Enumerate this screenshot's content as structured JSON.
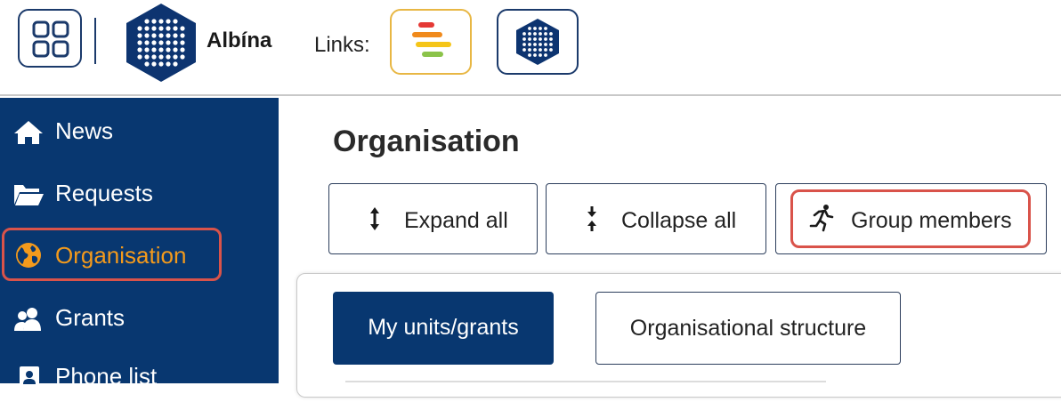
{
  "header": {
    "brand": "Albína",
    "links_label": "Links:",
    "icons": [
      "apps-grid-icon",
      "albina-logo-icon",
      "avalanche-report-link-icon",
      "albina-link-icon"
    ]
  },
  "sidebar": {
    "items": [
      {
        "label": "News",
        "icon": "home-icon"
      },
      {
        "label": "Requests",
        "icon": "folder-open-icon"
      },
      {
        "label": "Organisation",
        "icon": "globe-icon",
        "active": true
      },
      {
        "label": "Grants",
        "icon": "users-icon"
      },
      {
        "label": "Phone list",
        "icon": "phone-book-icon"
      }
    ]
  },
  "main": {
    "title": "Organisation",
    "toolbar": {
      "expand_label": "Expand all",
      "collapse_label": "Collapse all",
      "group_label": "Group members"
    },
    "tabs": [
      {
        "label": "My units/grants",
        "active": true
      },
      {
        "label": "Organisational structure",
        "active": false
      }
    ]
  },
  "colors": {
    "sidebar_bg": "#083770",
    "active_nav": "#f39a1c",
    "highlight": "#d9534a",
    "accent_dark": "#1b3a6b"
  }
}
